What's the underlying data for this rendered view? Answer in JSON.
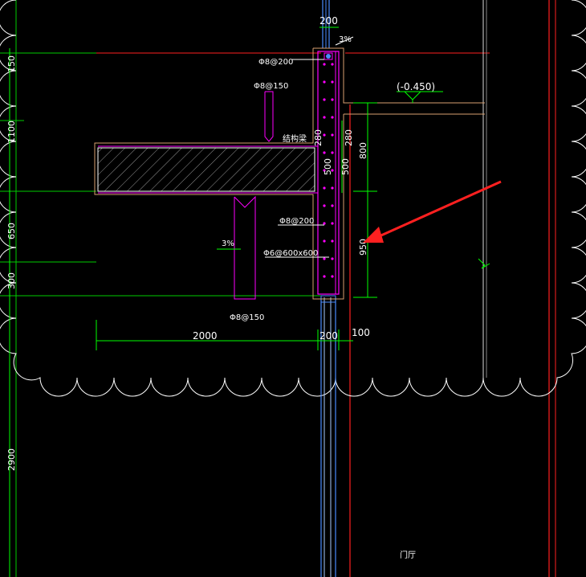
{
  "drawing": {
    "dimensions": {
      "top_200": "200",
      "bottom_2000": "2000",
      "bottom_200": "200",
      "bottom_100": "100",
      "right_800": "800",
      "right_950": "950",
      "left_150": "150",
      "left_1100": "1100",
      "left_650": "650",
      "left_300": "300",
      "left_2900": "2900",
      "wall_280_a": "280",
      "wall_280_b": "280",
      "wall_500_a": "500",
      "wall_500_b": "500"
    },
    "rebar_labels": {
      "top": "Φ8@200",
      "slab_top": "Φ8@150",
      "mid": "Φ8@200",
      "stirrup": "Φ6@600x600",
      "slab_bottom": "Φ8@150"
    },
    "slope_top": "3%",
    "slope_mid": "3%",
    "elevation": "-0.450",
    "slab_note": "结构梁",
    "room_label": "门厅"
  },
  "colors": {
    "green": "#00ff00",
    "magenta": "#ff00ff",
    "red": "#ff2020",
    "blue": "#4a8cff",
    "white": "#ffffff",
    "tan": "#d8a070"
  }
}
